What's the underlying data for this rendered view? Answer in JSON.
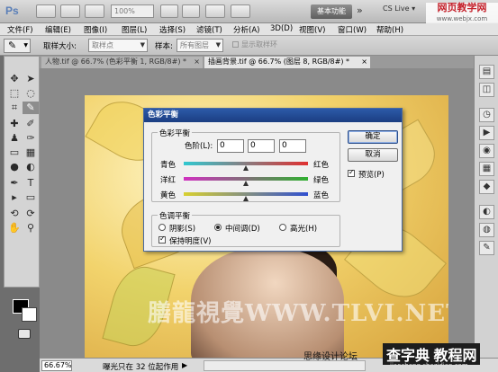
{
  "appbar": {
    "logo": "Ps",
    "zoom": "100%",
    "workspace": "基本功能",
    "more": "»",
    "cslive": "CS Live ▾",
    "watermark_top": "网页教学网",
    "watermark_top_url": "www.webjx.com"
  },
  "menu": [
    "文件(F)",
    "编辑(E)",
    "图像(I)",
    "图层(L)",
    "选择(S)",
    "滤镜(T)",
    "分析(A)",
    "3D(D)",
    "视图(V)",
    "窗口(W)",
    "帮助(H)"
  ],
  "options": {
    "sample_size_label": "取样大小:",
    "sample_size_value": "取样点",
    "sample_label": "样本:",
    "sample_value": "所有图层",
    "show_ring": "显示取样环"
  },
  "tabs": [
    {
      "label": "人物.tif @ 66.7% (色彩平衡 1, RGB/8#) *",
      "close": "×"
    },
    {
      "label": "插画背景.tif @ 66.7% (图层 8, RGB/8#) *",
      "close": "×"
    }
  ],
  "dialog": {
    "title": "色彩平衡",
    "balance_group": "色彩平衡",
    "levels_label": "色阶(L):",
    "levels": [
      "0",
      "0",
      "0"
    ],
    "sliders": [
      {
        "left": "青色",
        "right": "红色",
        "color": "#e03030",
        "left_color": "#30c8d0",
        "value": 0
      },
      {
        "left": "洋红",
        "right": "绿色",
        "color": "#30b030",
        "left_color": "#d030c0",
        "value": 0
      },
      {
        "left": "黄色",
        "right": "蓝色",
        "color": "#3050d0",
        "left_color": "#d8d030",
        "value": 0
      }
    ],
    "tone_group": "色调平衡",
    "tones": [
      "阴影(S)",
      "中间调(D)",
      "高光(H)"
    ],
    "tone_selected": "中间调(D)",
    "preserve_luminosity": "保持明度(V)",
    "preserve_checked": true,
    "ok": "确定",
    "cancel": "取消",
    "preview": "预览(P)",
    "preview_checked": true
  },
  "canvas": {
    "watermark": "膳龍視覺WWW.TLVI.NET"
  },
  "status": {
    "zoom": "66.67%",
    "text": "曝光只在 32 位起作用",
    "arrow": "▶"
  },
  "watermark_bottom": {
    "left": "思缘设计论坛",
    "mid": "查字典 教程网",
    "url": "jiaocheng.chazidian.com"
  }
}
